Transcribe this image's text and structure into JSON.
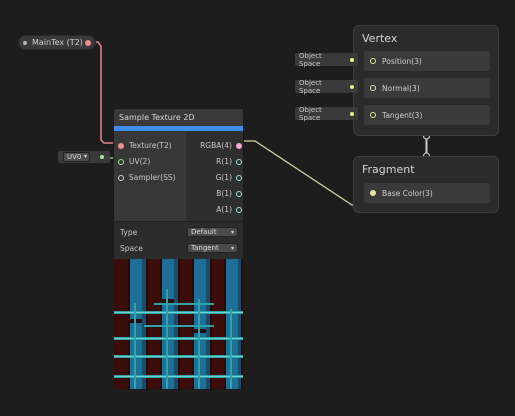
{
  "property_node": {
    "label": "MainTex (T2)"
  },
  "sample_node": {
    "title": "Sample Texture 2D",
    "inputs": [
      "Texture(T2)",
      "UV(2)",
      "Sampler(SS)"
    ],
    "outputs": [
      "RGBA(4)",
      "R(1)",
      "G(1)",
      "B(1)",
      "A(1)"
    ],
    "settings": [
      {
        "label": "Type",
        "value": "Default"
      },
      {
        "label": "Space",
        "value": "Tangent"
      }
    ]
  },
  "uv_input": {
    "value": "UV0"
  },
  "vertex": {
    "title": "Vertex",
    "blocks": [
      "Position(3)",
      "Normal(3)",
      "Tangent(3)"
    ],
    "space_tags": [
      "Object Space",
      "Object Space",
      "Object Space"
    ]
  },
  "fragment": {
    "title": "Fragment",
    "blocks": [
      "Base Color(3)"
    ]
  },
  "colors": {
    "background": "#1d1d1d",
    "accent_blue": "#3f8dea",
    "texture_wire": "#e48a8a",
    "color_wire": "#d9d9a3",
    "uv_wire": "#a7e8a0"
  }
}
